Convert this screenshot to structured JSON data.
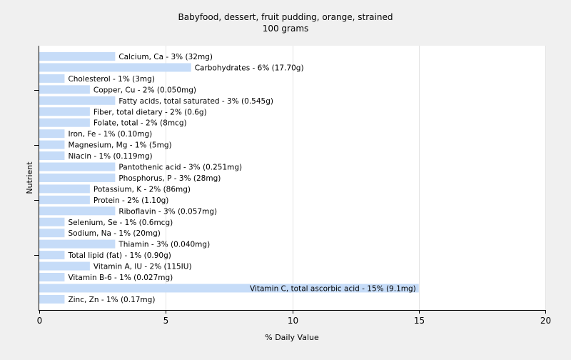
{
  "chart_data": {
    "type": "bar",
    "orientation": "horizontal",
    "title": "Babyfood, dessert, fruit pudding, orange, strained",
    "subtitle": "100 grams",
    "xlabel": "% Daily Value",
    "ylabel": "Nutrient",
    "xlim": [
      0,
      20
    ],
    "xticks": [
      0,
      5,
      10,
      15,
      20
    ],
    "grid": true,
    "bar_color": "#c6dcf8",
    "categories": [
      "Calcium, Ca",
      "Carbohydrates",
      "Cholesterol",
      "Copper, Cu",
      "Fatty acids, total saturated",
      "Fiber, total dietary",
      "Folate, total",
      "Iron, Fe",
      "Magnesium, Mg",
      "Niacin",
      "Pantothenic acid",
      "Phosphorus, P",
      "Potassium, K",
      "Protein",
      "Riboflavin",
      "Selenium, Se",
      "Sodium, Na",
      "Thiamin",
      "Total lipid (fat)",
      "Vitamin A, IU",
      "Vitamin B-6",
      "Vitamin C, total ascorbic acid",
      "Zinc, Zn"
    ],
    "values": [
      3,
      6,
      1,
      2,
      3,
      2,
      2,
      1,
      1,
      1,
      3,
      3,
      2,
      2,
      3,
      1,
      1,
      3,
      1,
      2,
      1,
      15,
      1
    ],
    "labels": [
      "Calcium, Ca - 3% (32mg)",
      "Carbohydrates - 6% (17.70g)",
      "Cholesterol - 1% (3mg)",
      "Copper, Cu - 2% (0.050mg)",
      "Fatty acids, total saturated - 3% (0.545g)",
      "Fiber, total dietary - 2% (0.6g)",
      "Folate, total - 2% (8mcg)",
      "Iron, Fe - 1% (0.10mg)",
      "Magnesium, Mg - 1% (5mg)",
      "Niacin - 1% (0.119mg)",
      "Pantothenic acid - 3% (0.251mg)",
      "Phosphorus, P - 3% (28mg)",
      "Potassium, K - 2% (86mg)",
      "Protein - 2% (1.10g)",
      "Riboflavin - 3% (0.057mg)",
      "Selenium, Se - 1% (0.6mcg)",
      "Sodium, Na - 1% (20mg)",
      "Thiamin - 3% (0.040mg)",
      "Total lipid (fat) - 1% (0.90g)",
      "Vitamin A, IU - 2% (115IU)",
      "Vitamin B-6 - 1% (0.027mg)",
      "Vitamin C, total ascorbic acid - 15% (9.1mg)",
      "Zinc, Zn - 1% (0.17mg)"
    ]
  }
}
